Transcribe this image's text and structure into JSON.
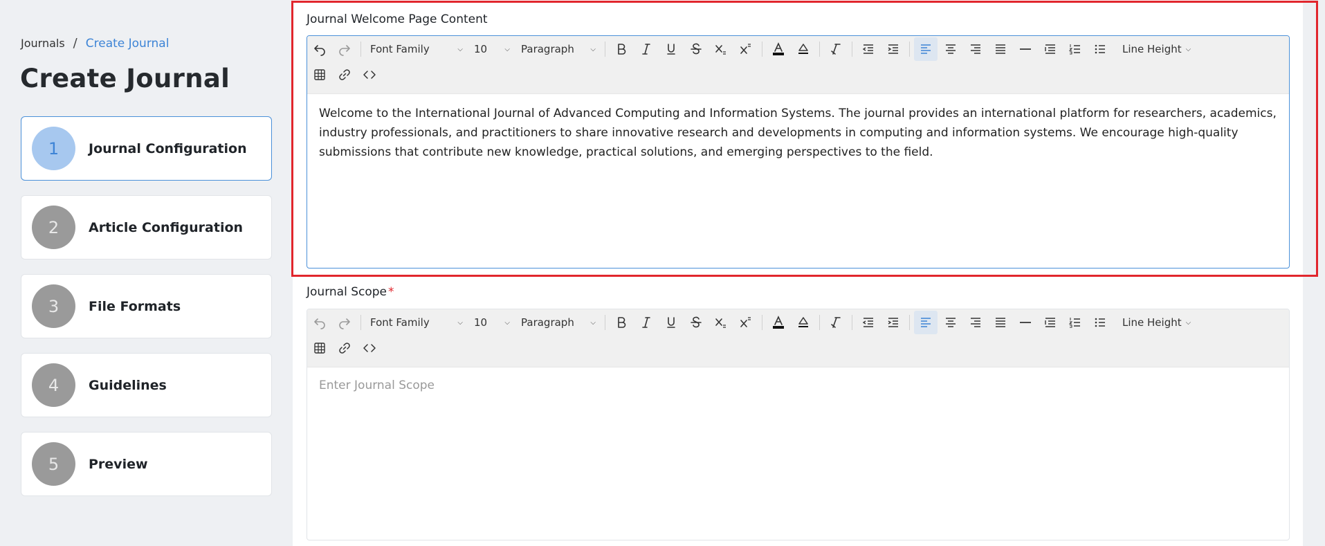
{
  "breadcrumb": {
    "root": "Journals",
    "separator": "/",
    "current": "Create Journal"
  },
  "page_title": "Create Journal",
  "steps": [
    {
      "number": "1",
      "label": "Journal Configuration",
      "active": true
    },
    {
      "number": "2",
      "label": "Article Configuration",
      "active": false
    },
    {
      "number": "3",
      "label": "File Formats",
      "active": false
    },
    {
      "number": "4",
      "label": "Guidelines",
      "active": false
    },
    {
      "number": "5",
      "label": "Preview",
      "active": false
    }
  ],
  "toolbar": {
    "font_family": "Font Family",
    "font_size": "10",
    "block_format": "Paragraph",
    "line_height": "Line Height"
  },
  "welcome_editor": {
    "label": "Journal Welcome Page Content",
    "content": "Welcome to the International Journal of Advanced Computing and Information Systems. The journal provides an international platform for researchers, academics, industry professionals, and practitioners to share innovative research and developments in computing and information systems. We encourage high-quality submissions that contribute new knowledge, practical solutions, and emerging perspectives to the field."
  },
  "scope_editor": {
    "label": "Journal Scope",
    "required_mark": "*",
    "placeholder": "Enter Journal Scope"
  },
  "colors": {
    "accent": "#3d84d6",
    "active_step_circle": "#a7c8ef",
    "inactive_step_circle": "#9a9a9a",
    "highlight_border": "#e1262d",
    "required": "#e1262d"
  },
  "icons": [
    "undo-icon",
    "redo-icon",
    "bold-icon",
    "italic-icon",
    "underline-icon",
    "strikethrough-icon",
    "subscript-icon",
    "superscript-icon",
    "text-color-icon",
    "highlight-color-icon",
    "clear-format-icon",
    "outdent-icon",
    "indent-icon",
    "align-left-icon",
    "align-center-icon",
    "align-right-icon",
    "align-justify-icon",
    "horizontal-rule-icon",
    "line-spacing-icon",
    "numbered-list-icon",
    "bullet-list-icon",
    "table-icon",
    "link-icon",
    "code-icon"
  ]
}
